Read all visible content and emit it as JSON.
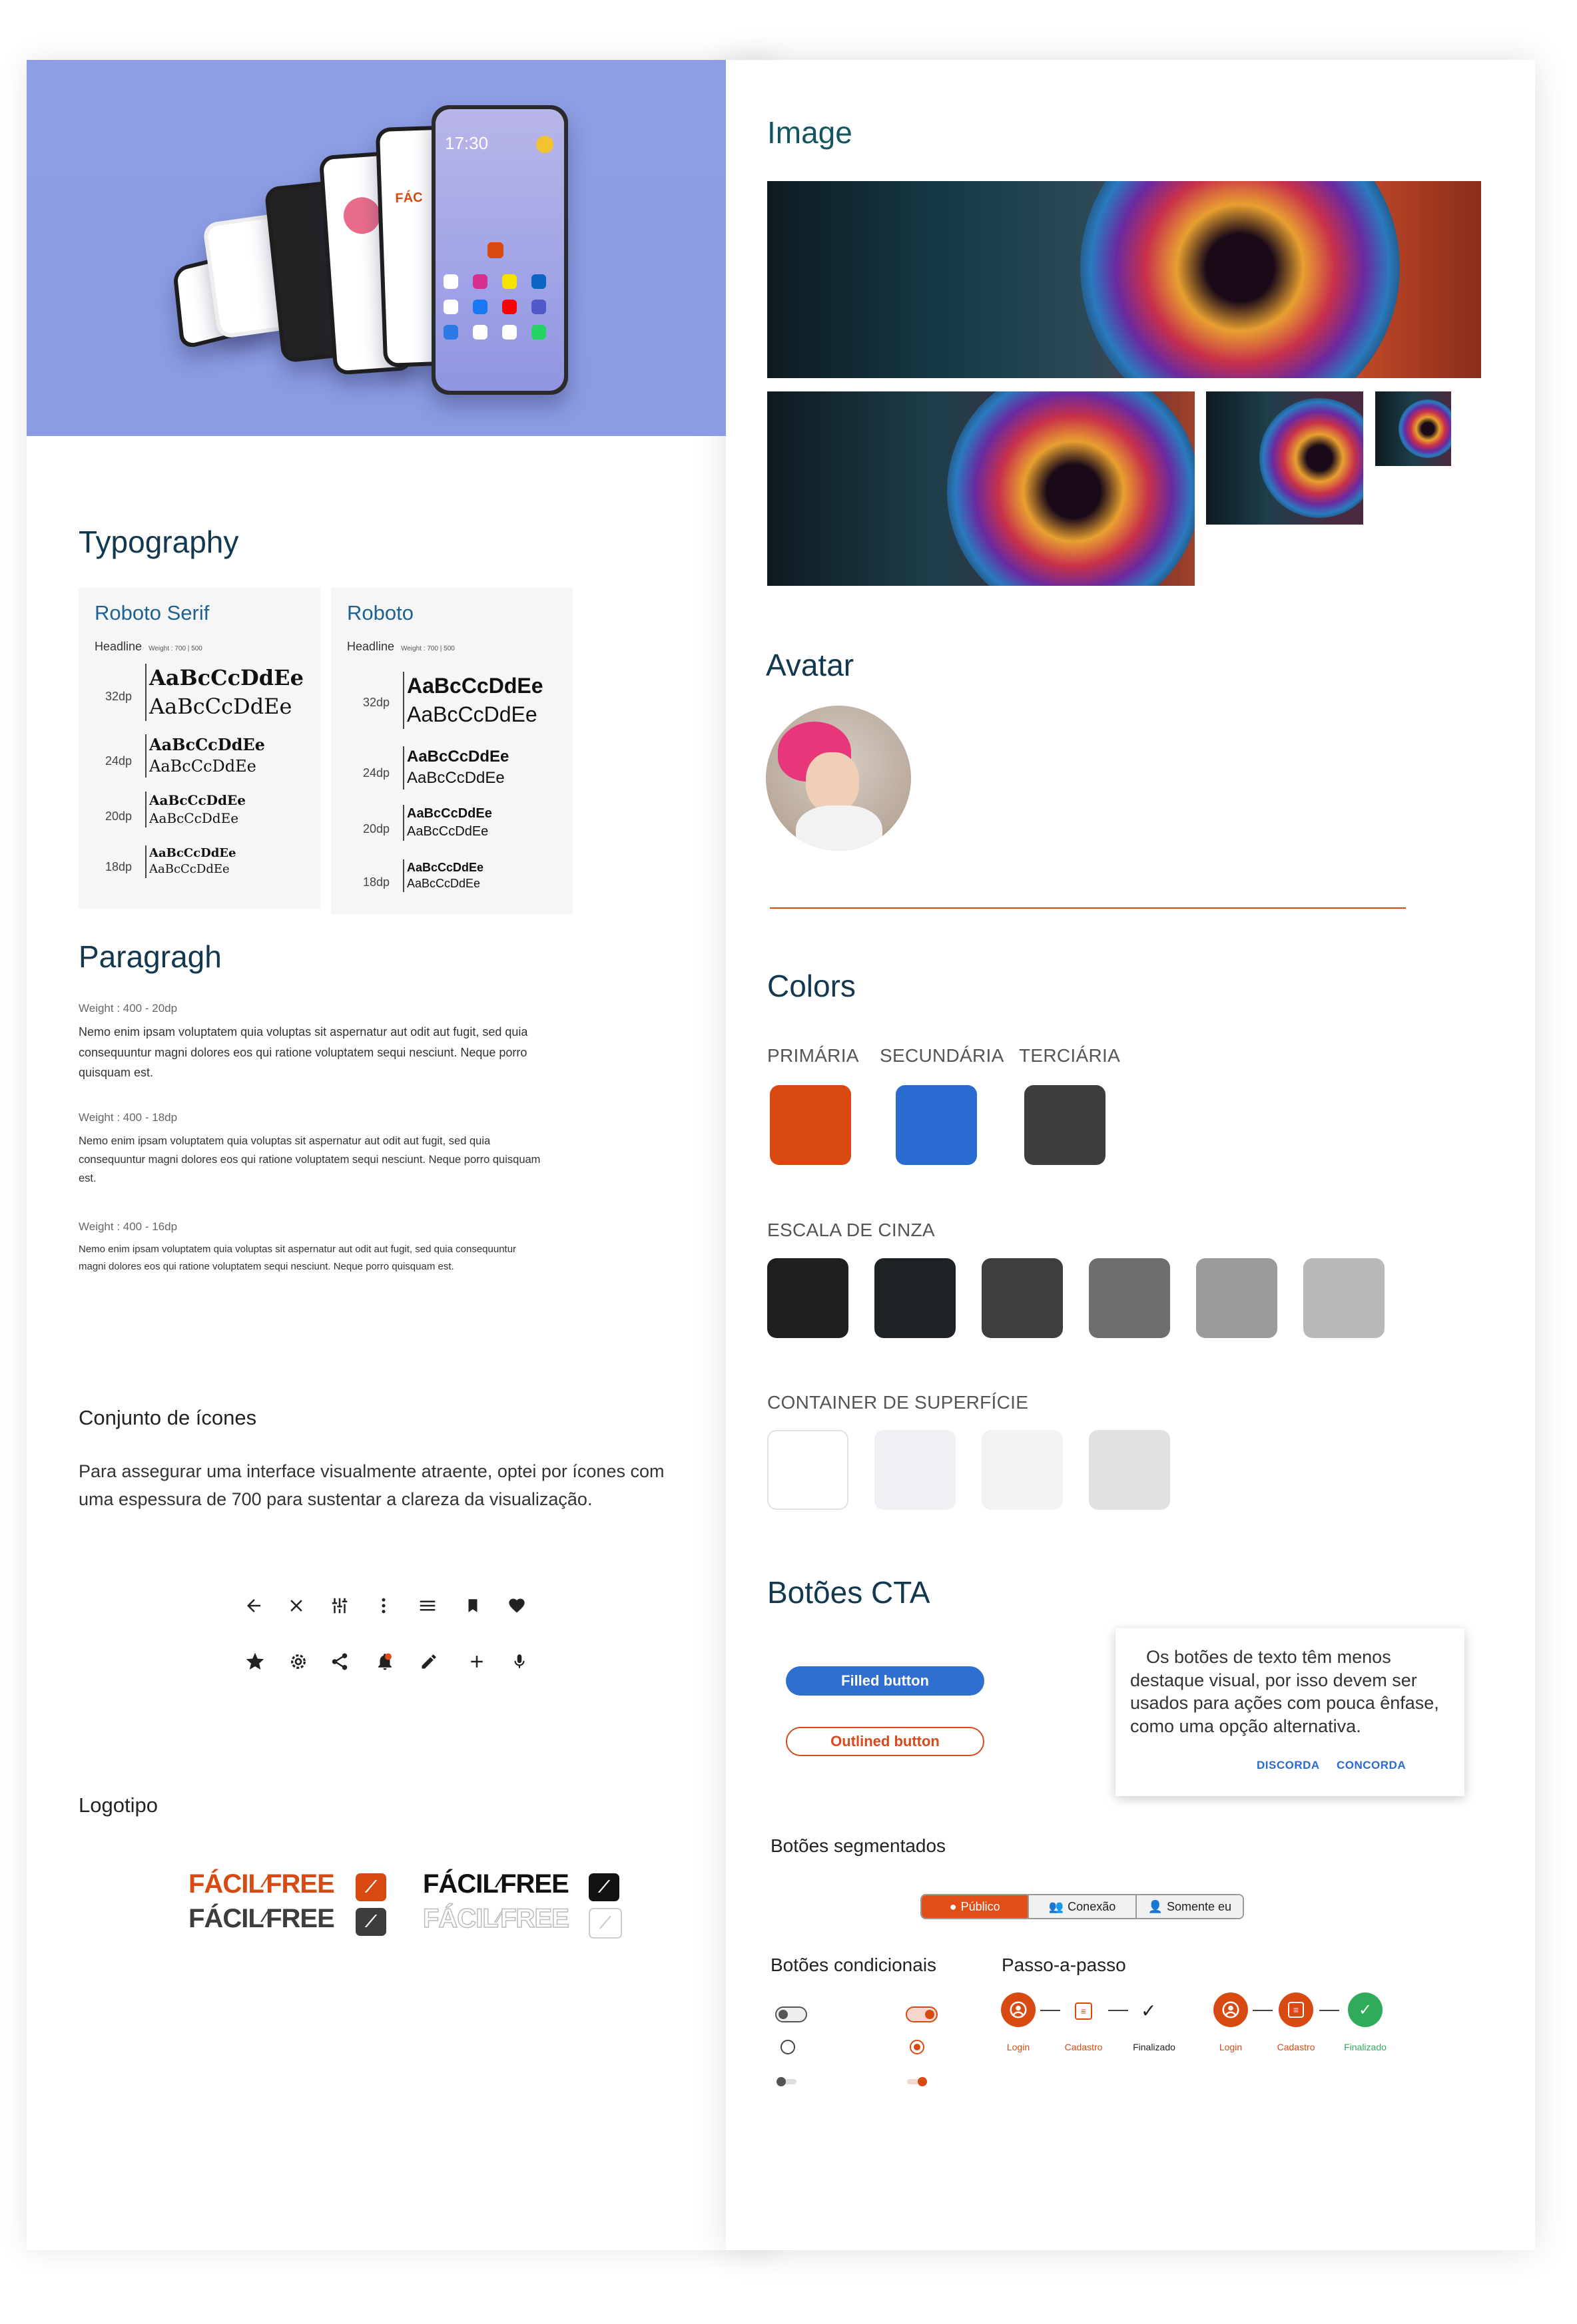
{
  "colors": {
    "primary": "#d84a12",
    "secondary": "#2a6bd0",
    "tertiary": "#3d3d3d",
    "accent_heading": "#12384f"
  },
  "hero": {
    "clock": "17:30"
  },
  "typography": {
    "title": "Typography",
    "cards": [
      {
        "name": "Roboto Serif",
        "headline": "Headline",
        "weight": "Weight : 700 | 500",
        "rows": [
          {
            "size": "32dp",
            "a": "AaBcCcDdEe",
            "b": "AaBcCcDdEe"
          },
          {
            "size": "24dp",
            "a": "AaBcCcDdEe",
            "b": "AaBcCcDdEe"
          },
          {
            "size": "20dp",
            "a": "AaBcCcDdEe",
            "b": "AaBcCcDdEe"
          },
          {
            "size": "18dp",
            "a": "AaBcCcDdEe",
            "b": "AaBcCcDdEe"
          }
        ]
      },
      {
        "name": "Roboto",
        "headline": "Headline",
        "weight": "Weight : 700 | 500",
        "rows": [
          {
            "size": "32dp",
            "a": "AaBcCcDdEe",
            "b": "AaBcCcDdEe"
          },
          {
            "size": "24dp",
            "a": "AaBcCcDdEe",
            "b": "AaBcCcDdEe"
          },
          {
            "size": "20dp",
            "a": "AaBcCcDdEe",
            "b": "AaBcCcDdEe"
          },
          {
            "size": "18dp",
            "a": "AaBcCcDdEe",
            "b": "AaBcCcDdEe"
          }
        ]
      }
    ]
  },
  "paragraph": {
    "title": "Paragragh",
    "blocks": [
      {
        "weight": "Weight : 400  -  20dp",
        "text": "Nemo enim ipsam voluptatem quia voluptas sit aspernatur aut odit aut fugit, sed quia consequuntur magni dolores eos qui ratione voluptatem sequi nesciunt. Neque porro quisquam est."
      },
      {
        "weight": "Weight : 400  -  18dp",
        "text": "Nemo enim ipsam voluptatem quia voluptas sit aspernatur aut odit aut fugit, sed quia consequuntur magni dolores eos qui ratione voluptatem sequi nesciunt. Neque porro quisquam est."
      },
      {
        "weight": "Weight : 400  -  16dp",
        "text": "Nemo enim ipsam voluptatem quia voluptas sit aspernatur aut odit aut fugit, sed quia consequuntur magni dolores eos qui ratione voluptatem sequi nesciunt. Neque porro quisquam est."
      }
    ]
  },
  "icons": {
    "title": "Conjunto de ícones",
    "description": "Para assegurar uma interface visualmente atraente, optei por ícones com uma espessura de 700 para sustentar a clareza da visualização.",
    "row1": [
      "arrow-back-icon",
      "close-icon",
      "tune-icon",
      "more-vert-icon",
      "menu-icon",
      "bookmark-icon",
      "heart-icon"
    ],
    "row2": [
      "star-icon",
      "settings-icon",
      "share-icon",
      "notification-icon",
      "edit-icon",
      "add-icon",
      "mic-icon"
    ]
  },
  "logo": {
    "title": "Logotipo",
    "word1": "FÁCIL",
    "word2": "FREE"
  },
  "image": {
    "title": "Image"
  },
  "avatar": {
    "title": "Avatar"
  },
  "color_section": {
    "title": "Colors",
    "primary_label": "PRIMÁRIA",
    "secondary_label": "SECUNDÁRIA",
    "tertiary_label": "TERCIÁRIA",
    "gray_label": "ESCALA DE CINZA",
    "grays": [
      "#1f1f1f",
      "#1e2226",
      "#3e3e3e",
      "#6e6e6e",
      "#9b9b9b",
      "#b9b9b9"
    ],
    "surface_label": "CONTAINER DE SUPERFÍCIE",
    "surfaces": [
      "#ffffff",
      "#eff1f4",
      "#f2f2f2",
      "#e1e1e1"
    ]
  },
  "cta": {
    "title": "Botões CTA",
    "filled": "Filled button",
    "outlined": "Outlined button",
    "dialog_text": "Os botões de texto têm menos destaque visual, por isso devem ser usados para ações com pouca ênfase, como uma opção alternativa.",
    "dialog_disagree": "DISCORDA",
    "dialog_agree": "CONCORDA"
  },
  "segmented": {
    "title": "Botões segmentados",
    "options": [
      "Público",
      "Conexão",
      "Somente eu"
    ]
  },
  "conditional": {
    "title": "Botões condicionais"
  },
  "stepper": {
    "title": "Passo-a-passo",
    "steps": [
      "Login",
      "Cadastro",
      "Finalizado"
    ]
  }
}
